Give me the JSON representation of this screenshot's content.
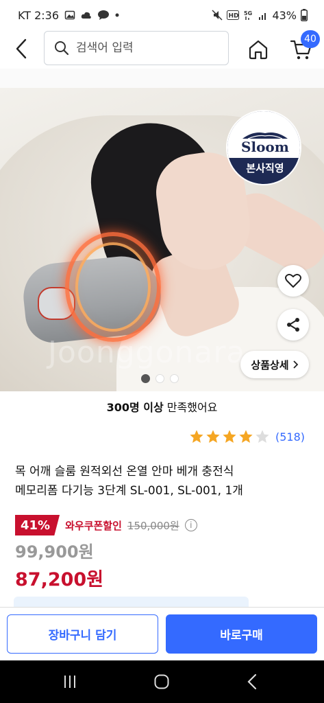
{
  "status_bar": {
    "carrier_time": "KT 2:36",
    "battery": "43%",
    "icons": [
      "image-icon",
      "cloud-icon",
      "chat-icon",
      "dot-icon",
      "mute-icon",
      "hd-icon",
      "5g-icon",
      "signal-icon",
      "battery-icon"
    ]
  },
  "header": {
    "search_placeholder": "검색어 입력",
    "cart_count": "40"
  },
  "product_image": {
    "watermark": "Joonggonara",
    "brand_name": "Sloom",
    "brand_sub": "본사직영",
    "detail_button": "상품상세",
    "slide_count": 3,
    "active_slide": 1
  },
  "satisfaction": {
    "bold": "300명 이상",
    "rest": " 만족했어요"
  },
  "rating": {
    "stars": 4,
    "max": 5,
    "count": "(518)"
  },
  "product": {
    "title_line1": "목 어깨 슬룸 원적외선 온열 안마 베개 충전식",
    "title_line2": "메모리폼 다기능 3단계 SL-001, SL-001, 1개"
  },
  "pricing": {
    "discount_pct": "41%",
    "coupon_label": "와우쿠폰할인",
    "original_price": "150,000원",
    "info": "i",
    "price": "99,900원",
    "coupon_price": "87,200원"
  },
  "actions": {
    "cart_button": "장바구니 담기",
    "buy_button": "바로구매"
  },
  "colors": {
    "accent_blue": "#346aff",
    "discount_red": "#c8102e",
    "brand_navy": "#1e2a54"
  }
}
